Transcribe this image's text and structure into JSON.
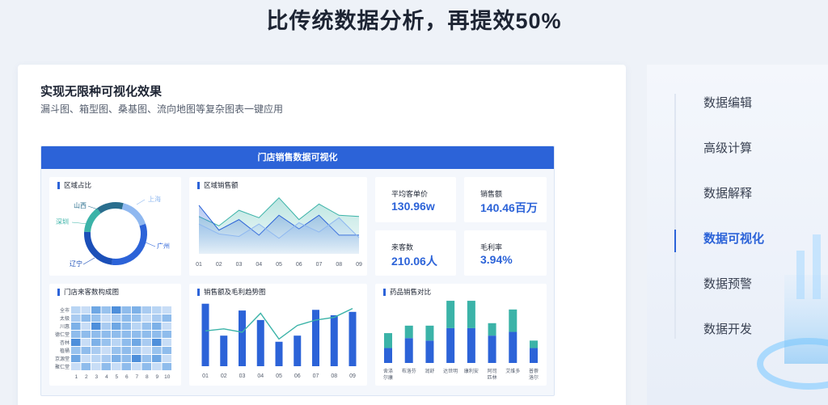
{
  "hero": {
    "title": "比传统数据分析，再提效50%"
  },
  "card": {
    "title": "实现无限种可视化效果",
    "subtitle": "漏斗图、箱型图、桑基图、流向地图等复杂图表一键应用"
  },
  "dashboard": {
    "title": "门店销售数据可视化",
    "donut": {
      "title": "区域占比",
      "labels": [
        "上海",
        "山西",
        "深圳",
        "辽宁",
        "广州"
      ]
    },
    "area": {
      "title": "区域销售额",
      "x": [
        "01",
        "02",
        "03",
        "04",
        "05",
        "06",
        "07",
        "08",
        "09"
      ]
    },
    "kpis": [
      {
        "label": "平均客单价",
        "value": "130.96w"
      },
      {
        "label": "销售额",
        "value": "140.46百万"
      },
      {
        "label": "来客数",
        "value": "210.06人"
      },
      {
        "label": "毛利率",
        "value": "3.94%"
      }
    ],
    "heatmap": {
      "title": "门店来客数构成图",
      "rows": [
        "全市",
        "太极",
        "川惠",
        "德仁堂",
        "杏林",
        "植桶",
        "京源堂",
        "聚仁堂"
      ],
      "cols": [
        "1",
        "2",
        "3",
        "4",
        "5",
        "6",
        "7",
        "8",
        "9",
        "10"
      ]
    },
    "combo": {
      "title": "销售额及毛利趋势图",
      "x": [
        "01",
        "02",
        "03",
        "04",
        "05",
        "06",
        "07",
        "08",
        "09"
      ]
    },
    "stacked": {
      "title": "药品销售对比",
      "categories": [
        "舍涤尔康",
        "布洛芬",
        "润舒",
        "达世明",
        "康利安",
        "阿司匹林",
        "艾维多",
        "普萘洛尔"
      ]
    }
  },
  "chart_data": [
    {
      "type": "pie",
      "title": "区域占比",
      "categories": [
        "上海",
        "广州",
        "辽宁",
        "深圳",
        "山西"
      ],
      "values": [
        16,
        32,
        24,
        14,
        14
      ]
    },
    {
      "type": "area",
      "title": "区域销售额",
      "x": [
        "01",
        "02",
        "03",
        "04",
        "05",
        "06",
        "07",
        "08",
        "09"
      ],
      "series": [
        {
          "values": [
            60,
            45,
            70,
            58,
            90,
            55,
            80,
            62,
            60
          ]
        },
        {
          "values": [
            78,
            38,
            55,
            30,
            62,
            40,
            62,
            30,
            30
          ]
        },
        {
          "values": [
            48,
            32,
            28,
            48,
            25,
            50,
            35,
            58,
            26
          ]
        }
      ]
    },
    {
      "type": "heatmap",
      "title": "门店来客数构成图",
      "rows": [
        "全市",
        "太极",
        "川惠",
        "德仁堂",
        "杏林",
        "植桶",
        "京源堂",
        "聚仁堂"
      ],
      "cols": [
        "1",
        "2",
        "3",
        "4",
        "5",
        "6",
        "7",
        "8",
        "9",
        "10"
      ]
    },
    {
      "type": "bar",
      "title": "销售额及毛利趋势图",
      "x": [
        "01",
        "02",
        "03",
        "04",
        "05",
        "06",
        "07",
        "08",
        "09"
      ],
      "series": [
        {
          "type": "bar",
          "values": [
            92,
            45,
            82,
            68,
            36,
            45,
            83,
            75,
            80
          ]
        },
        {
          "type": "line",
          "values": [
            52,
            55,
            50,
            78,
            40,
            60,
            68,
            72,
            85
          ]
        }
      ]
    },
    {
      "type": "bar",
      "title": "药品销售对比",
      "categories": [
        "舍涤尔康",
        "布洛芬",
        "润舒",
        "达世明",
        "康利安",
        "阿司匹林",
        "艾维多",
        "普萘洛尔"
      ],
      "series": [
        {
          "values": [
            12,
            20,
            18,
            28,
            28,
            22,
            25,
            12
          ]
        },
        {
          "values": [
            12,
            10,
            12,
            22,
            22,
            10,
            18,
            6
          ]
        }
      ]
    }
  ],
  "nav": {
    "items": [
      "数据编辑",
      "高级计算",
      "数据解释",
      "数据可视化",
      "数据预警",
      "数据开发"
    ],
    "active": 3
  },
  "colors": {
    "accent": "#2c63d8",
    "teal": "#3bb3a8",
    "lightblue": "#8fb8f0"
  }
}
